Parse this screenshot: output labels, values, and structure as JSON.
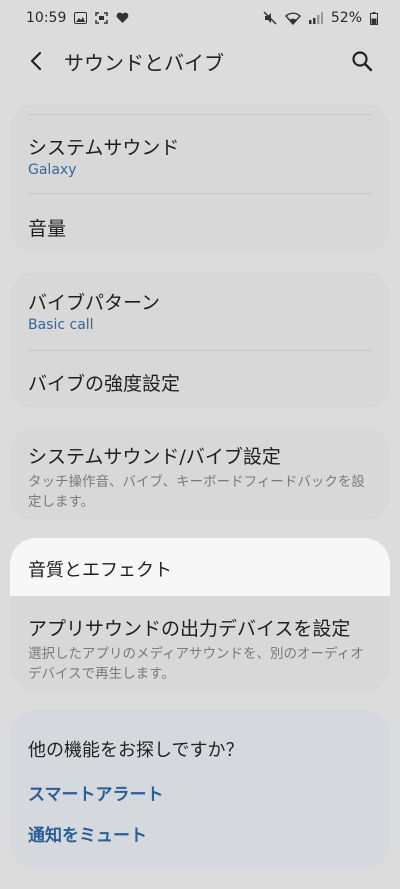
{
  "status": {
    "time": "10:59",
    "battery": "52%"
  },
  "header": {
    "title": "サウンドとバイブ"
  },
  "cards": {
    "system_sound_title": "システムサウンド",
    "system_sound_sub": "Galaxy",
    "volume": "音量",
    "vibe_pattern_title": "バイブパターン",
    "vibe_pattern_sub": "Basic call",
    "vibe_intensity": "バイブの強度設定",
    "sys_settings_title": "システムサウンド/バイブ設定",
    "sys_settings_desc": "タッチ操作音、バイブ、キーボードフィードバックを設定します。",
    "sound_quality": "音質とエフェクト",
    "app_output_title": "アプリサウンドの出力デバイスを設定",
    "app_output_desc": "選択したアプリのメディアサウンドを、別のオーディオデバイスで再生します。"
  },
  "more": {
    "title": "他の機能をお探しですか？",
    "link1": "スマートアラート",
    "link2": "通知をミュート"
  },
  "colors": {
    "accent_blue": "#2b5d9a",
    "sub_blue": "#2d6aa3"
  }
}
